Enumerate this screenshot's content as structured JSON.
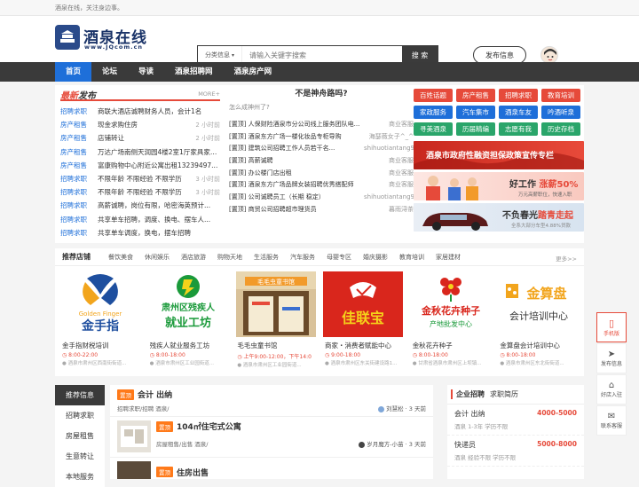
{
  "topbar": {
    "text": "酒泉在线，关注身边事。"
  },
  "logo": {
    "text": "酒泉在线",
    "sub": "www.JQcom.cn"
  },
  "search": {
    "category": "分类信息",
    "placeholder": "请输入关键字搜索",
    "button": "搜 索"
  },
  "post_button": "发布信息",
  "nav": [
    "首页",
    "论坛",
    "导读",
    "酒泉招聘网",
    "酒泉房产网"
  ],
  "latest": {
    "title_hot": "最新",
    "title_rest": "发布",
    "more": "MORE+",
    "rows": [
      {
        "cat": "招聘求职",
        "text": "商联大酒店诚聘财务人员，会计1名",
        "time": ""
      },
      {
        "cat": "房产租售",
        "text": "现金求购住房",
        "time": "2 小时前"
      },
      {
        "cat": "房产租售",
        "text": "店铺转让",
        "time": "2 小时前"
      },
      {
        "cat": "房产租售",
        "text": "万达广场南侧天润园4楼2室1厅家具家电齐全...",
        "time": ""
      },
      {
        "cat": "房产租售",
        "text": "富康购物中心附近公寓出租13239497...",
        "time": ""
      },
      {
        "cat": "招聘求职",
        "text": "不限年龄 不限经验 不限学历",
        "time": "3 小时前"
      },
      {
        "cat": "招聘求职",
        "text": "不限年龄 不限经验 不限学历",
        "time": "3 小时前"
      },
      {
        "cat": "招聘求职",
        "text": "高薪诚聘，岗位有限，哈密海英预计...",
        "time": ""
      },
      {
        "cat": "招聘求职",
        "text": "共享单车招聘，调度、换电、摆车人...",
        "time": ""
      },
      {
        "cat": "招聘求职",
        "text": "共享单车调度，换电，摆车招聘",
        "time": ""
      }
    ]
  },
  "mid": {
    "title": "不是神舟路吗?",
    "subtitle": "怎么成神州了?",
    "rows": [
      {
        "text": "[置顶] 人保财险酒泉市分公司线上服务团队电...",
        "tag": "商业客服"
      },
      {
        "text": "[置顶] 酒泉东方广场一楼化妆品专柜导购",
        "tag": "海瑟薇女子^_^"
      },
      {
        "text": "[置顶] 建筑公司招聘工作人员若干名...",
        "tag": "shihuotiantang9"
      },
      {
        "text": "[置顶] 高薪诚聘",
        "tag": "商业客服"
      },
      {
        "text": "[置顶] 办公楼门店出租",
        "tag": "商业客服"
      },
      {
        "text": "[置顶] 酒泉东方广场品牌女装招聘优秀搭配师",
        "tag": "商业客服"
      },
      {
        "text": "[置顶] 公司诚聘员工（长期 稳定）",
        "tag": "shihuotiantang9"
      },
      {
        "text": "[置顶] 商贸公司招聘超市理货员",
        "tag": "暮雨浔茶"
      }
    ]
  },
  "tags": [
    {
      "label": "百姓话题",
      "color": "#e64a3a"
    },
    {
      "label": "房产租售",
      "color": "#e64a3a"
    },
    {
      "label": "招聘求职",
      "color": "#e64a3a"
    },
    {
      "label": "教育培训",
      "color": "#e64a3a"
    },
    {
      "label": "家政服务",
      "color": "#1e6fd9"
    },
    {
      "label": "汽车集市",
      "color": "#1e6fd9"
    },
    {
      "label": "酒泉车友",
      "color": "#1e6fd9"
    },
    {
      "label": "吟酒听泉",
      "color": "#1e6fd9"
    },
    {
      "label": "寻美酒泉",
      "color": "#2aa56a"
    },
    {
      "label": "历届精编",
      "color": "#2aa56a"
    },
    {
      "label": "志愿有我",
      "color": "#2aa56a"
    },
    {
      "label": "历史存档",
      "color": "#2aa56a"
    }
  ],
  "banners": [
    {
      "text": "酒泉市政府性融资担保政策宣传专栏",
      "sub": ""
    },
    {
      "text": "好工作",
      "accent": "涨薪50%",
      "sub": "万元高薪职位，快速入职"
    },
    {
      "text": "不负春光",
      "accent": "踏青走起",
      "sub": "全系大部分车型4.88%贷款"
    }
  ],
  "recommend": {
    "title": "推荐店铺",
    "cats": [
      "餐饮美食",
      "休闲娱乐",
      "酒店旅游",
      "购物天地",
      "生活服务",
      "汽车服务",
      "母婴专区",
      "婚庆摄影",
      "教育培训",
      "家居建材"
    ],
    "more": "更多>>",
    "shops": [
      {
        "name": "金手指财税培训",
        "logo": "GoldenFinger 金手指",
        "time": "8:00-22:00",
        "addr": "酒泉市肃州区西南街街道..."
      },
      {
        "name": "残疾人就业服务工坊",
        "logo": "肃州区残疾人就业工坊",
        "time": "8:00-18:00",
        "addr": "酒泉市肃州区工业园街道..."
      },
      {
        "name": "毛毛虫童书馆",
        "logo": "毛毛虫童书馆",
        "time": "上午9:00-12:00，下午14:0",
        "addr": "酒泉市肃州区工业园街道..."
      },
      {
        "name": "商家・消费者赋能中心",
        "logo": "佳联宝",
        "time": "9:00-18:00",
        "addr": "酒泉市肃州区东关街建设路1..."
      },
      {
        "name": "金秋花卉种子",
        "logo": "金秋花卉种子 产地批发中心",
        "time": "8:00-18:00",
        "addr": "甘肃省酒泉市肃州区上坝镇..."
      },
      {
        "name": "金算盘会计培训中心",
        "logo": "金算盘 会计培训中心",
        "time": "8:00-18:00",
        "addr": "酒泉市肃州区东北街街道..."
      }
    ]
  },
  "sidemenu": [
    "推荐信息",
    "招聘求职",
    "房屋租售",
    "生意转让",
    "本地服务"
  ],
  "feed": [
    {
      "badge": "置顶",
      "title": "会计 出纳",
      "meta": "招聘求职/招聘 酒泉/",
      "user": "刘慧松",
      "time": "3 天前"
    },
    {
      "badge": "置顶",
      "title": "104㎡住宅式公寓",
      "meta": "房屋租售/出售 酒泉/",
      "user": "岁月魔方-小苗",
      "time": "3 天前"
    },
    {
      "badge": "置顶",
      "title": "住房出售",
      "meta": "",
      "user": "",
      "time": ""
    }
  ],
  "jobs": {
    "tabs": [
      "企业招聘",
      "求职简历"
    ],
    "items": [
      {
        "title": "会计 出纳",
        "salary": "4000-5000",
        "meta": "酒泉   1-3年   学历不限"
      },
      {
        "title": "快递员",
        "salary": "5000-8000",
        "meta": "酒泉   经验不限   学历不限"
      }
    ]
  },
  "floats": [
    "手机版",
    "发布信息",
    "好店入驻",
    "联系客服"
  ]
}
